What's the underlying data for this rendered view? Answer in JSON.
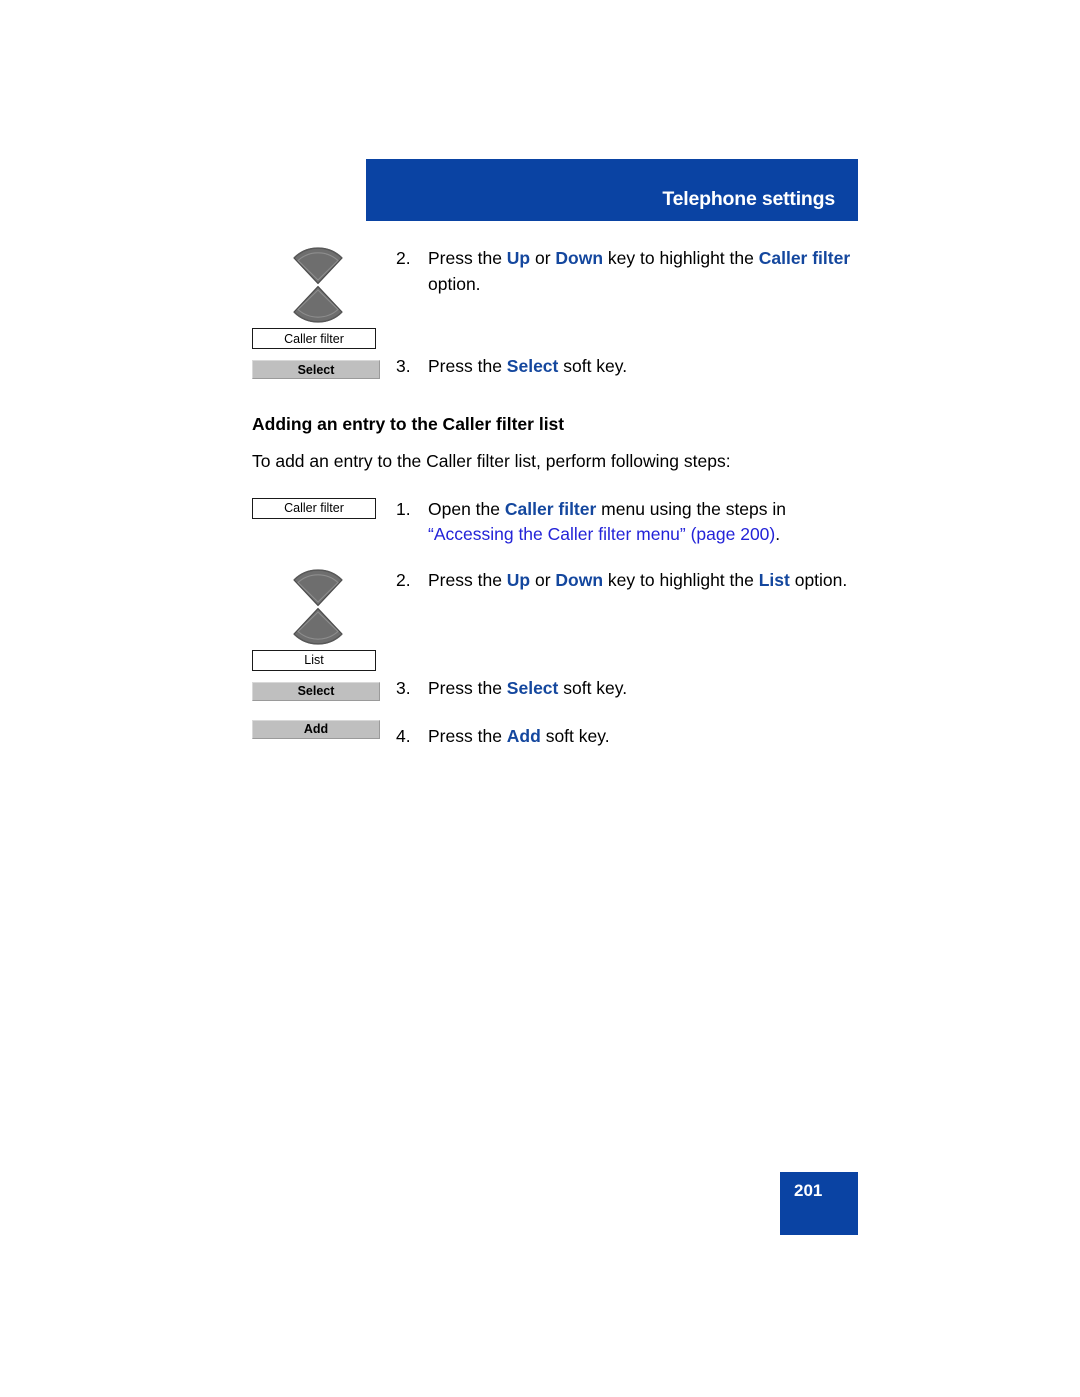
{
  "header": {
    "title": "Telephone settings"
  },
  "top_steps": [
    {
      "number": "2.",
      "art": "navkey",
      "segments": [
        {
          "t": "Press the ",
          "s": "plain"
        },
        {
          "t": "Up",
          "s": "kw"
        },
        {
          "t": " or ",
          "s": "plain"
        },
        {
          "t": "Down",
          "s": "kw"
        },
        {
          "t": " key to highlight the ",
          "s": "plain"
        },
        {
          "t": "Caller filter",
          "s": "kw"
        },
        {
          "t": " option.",
          "s": "plain"
        }
      ]
    },
    {
      "number": "3.",
      "art": "display_softkey",
      "display_label": "Caller filter",
      "softkey_label": "Select",
      "segments": [
        {
          "t": "Press the ",
          "s": "plain"
        },
        {
          "t": "Select",
          "s": "kw"
        },
        {
          "t": " soft key.",
          "s": "plain"
        }
      ]
    }
  ],
  "section": {
    "heading": "Adding an entry to the Caller filter list",
    "intro": "To add an entry to the Caller filter list, perform following steps:"
  },
  "add_steps": [
    {
      "number": "1.",
      "art": "display",
      "display_label": "Caller filter",
      "segments": [
        {
          "t": "Open the ",
          "s": "plain"
        },
        {
          "t": "Caller filter",
          "s": "kw"
        },
        {
          "t": " menu using the steps in ",
          "s": "plain"
        },
        {
          "t": "“Accessing the Caller filter menu” (page 200)",
          "s": "xref"
        },
        {
          "t": ".",
          "s": "plain"
        }
      ]
    },
    {
      "number": "2.",
      "art": "navkey",
      "segments": [
        {
          "t": "Press the ",
          "s": "plain"
        },
        {
          "t": "Up",
          "s": "kw"
        },
        {
          "t": " or ",
          "s": "plain"
        },
        {
          "t": "Down",
          "s": "kw"
        },
        {
          "t": " key to highlight the ",
          "s": "plain"
        },
        {
          "t": "List",
          "s": "kw"
        },
        {
          "t": " option.",
          "s": "plain"
        }
      ]
    },
    {
      "number": "3.",
      "art": "display_softkey",
      "display_label": "List",
      "softkey_label": "Select",
      "segments": [
        {
          "t": "Press the ",
          "s": "plain"
        },
        {
          "t": "Select",
          "s": "kw"
        },
        {
          "t": " soft key.",
          "s": "plain"
        }
      ]
    },
    {
      "number": "4.",
      "art": "softkey",
      "softkey_label": "Add",
      "segments": [
        {
          "t": "Press the ",
          "s": "plain"
        },
        {
          "t": "Add",
          "s": "kw"
        },
        {
          "t": " soft key.",
          "s": "plain"
        }
      ]
    }
  ],
  "footer": {
    "page_number": "201"
  },
  "colors": {
    "brand_blue": "#0a43a3",
    "keyword_blue": "#14479e",
    "xref_blue": "#2323d8",
    "softkey_gray": "#bfbfbf",
    "icon_gray": "#6e6e6e"
  }
}
